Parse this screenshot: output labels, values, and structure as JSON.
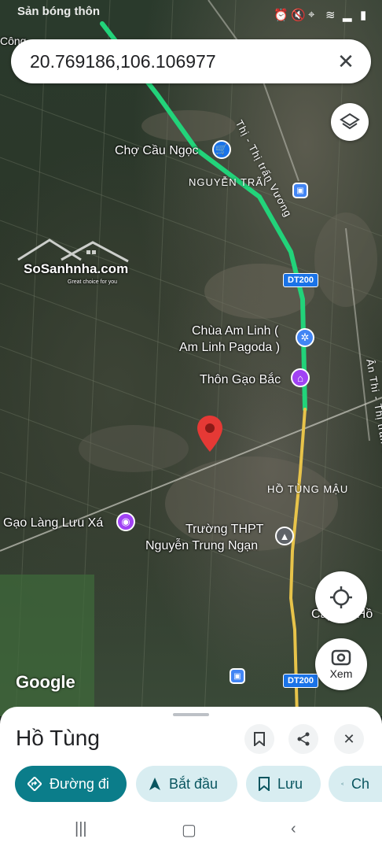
{
  "status_bar": {
    "left_text": "Sản bóng thôn"
  },
  "search": {
    "value": "20.769186,106.106977"
  },
  "map": {
    "labels": {
      "cho_cau_ngoc": "Chợ Cầu Ngọc",
      "nguyen_trai": "NGUYỄN TRÃI",
      "chua_am_linh_1": "Chùa Am Linh (",
      "chua_am_linh_2": "Am Linh Pagoda )",
      "thon_gao_bac": "Thôn Gạo Bắc",
      "ho_tung_mau": "HỒ TÙNG MẬU",
      "gao_lang": "Gạo Làng Lưu Xá",
      "truong_1": "Trường THPT",
      "truong_2": "Nguyễn Trung Ngạn",
      "cay_ho": "Cây Đa Hồ",
      "thi_tran_1": "Thị - Thị trấn Vương",
      "thi_tran_2": "Ân Thi - Thị trấn Vương",
      "cong_truncated": "Công"
    },
    "shields": {
      "dt200_top": "DT200",
      "dt200_bottom": "DT200"
    },
    "watermark": {
      "brand": "SoSanhnha.com",
      "tagline": "Great choice for you"
    },
    "google": "Google",
    "xem_label": "Xem"
  },
  "sheet": {
    "title": "Hồ Tùng",
    "chips": [
      {
        "label": "Đường đi",
        "icon": "directions-icon"
      },
      {
        "label": "Bắt đầu",
        "icon": "navigation-arrow-icon"
      },
      {
        "label": "Lưu",
        "icon": "bookmark-icon"
      },
      {
        "label": "Ch",
        "icon": "share-icon"
      }
    ]
  },
  "colors": {
    "accent": "#0b7d8a",
    "chip_bg": "#d8edf1",
    "pin": "#e53935",
    "route": "#22d37a"
  }
}
